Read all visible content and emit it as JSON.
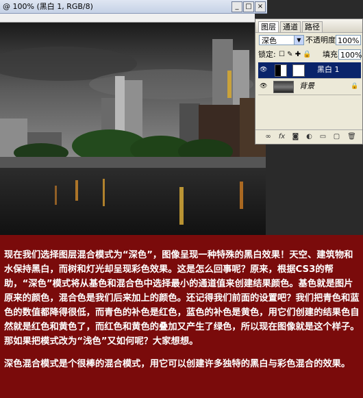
{
  "window": {
    "title": "@ 100% (黑白 1, RGB/8)",
    "minimize": "_",
    "maximize": "□",
    "close": "×"
  },
  "layers_panel": {
    "tabs": [
      "图层",
      "通道",
      "路径"
    ],
    "blend_mode": "深色",
    "opacity_label": "不透明度:",
    "opacity_value": "100%",
    "lock_label": "锁定:",
    "fill_label": "填充:",
    "fill_value": "100%",
    "layers": [
      {
        "name": "黑白 1",
        "selected": true
      },
      {
        "name": "背景",
        "selected": false
      }
    ],
    "footer_icons": [
      "link-icon",
      "fx-icon",
      "mask-icon",
      "adjustment-icon",
      "group-icon",
      "new-layer-icon",
      "trash-icon"
    ]
  },
  "caption": {
    "paragraph1": "现在我们选择图层混合模式为“深色”，图像呈现一种特殊的黑白效果！天空、建筑物和水保持黑白，而树和灯光却呈现彩色效果。这是怎么回事呢？原来，根据CS3的帮助，“深色”模式将从基色和混合色中选择最小的通道值来创建结果颜色。基色就是图片原来的颜色，混合色是我们后来加上的颜色。还记得我们前面的设置吧？我们把青色和蓝色的数值都降得很低，而青色的补色是红色，蓝色的补色是黄色，用它们创建的结果色自然就是红色和黄色了，而红色和黄色的叠加又产生了绿色，所以现在图像就是这个样子。那如果把模式改为“浅色”又如何呢？大家想想。",
    "paragraph2": "深色混合模式是个很棒的混合模式，用它可以创建许多独特的黑白与彩色混合的效果。"
  },
  "colors": {
    "background": "#7a0b0b",
    "selection": "#0a246a"
  }
}
